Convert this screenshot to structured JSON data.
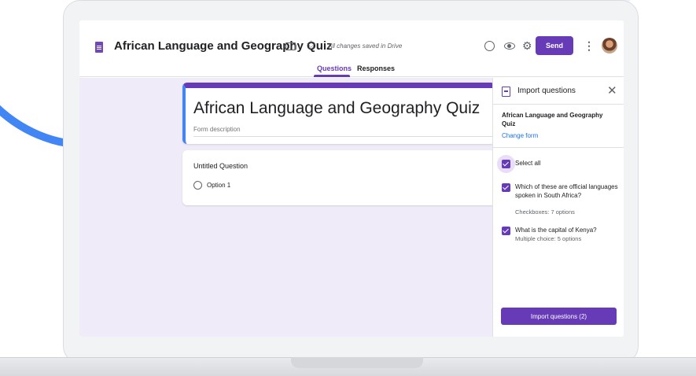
{
  "header": {
    "form_title": "African Language and Geography Quiz",
    "save_status": "All changes saved in Drive",
    "send_label": "Send",
    "icons": [
      "forms-doc-icon",
      "folder-icon",
      "star-icon",
      "palette-icon",
      "eye-icon",
      "gear-icon",
      "more-vert-icon",
      "avatar"
    ]
  },
  "tabs": [
    {
      "label": "Questions",
      "active": true
    },
    {
      "label": "Responses",
      "active": false
    }
  ],
  "form": {
    "title": "African Language and Geography Quiz",
    "description_placeholder": "Form description",
    "question": {
      "title": "Untitled Question",
      "options": [
        "Option 1"
      ]
    }
  },
  "import_panel": {
    "title": "Import questions",
    "source_form_name": "African Language and Geography Quiz",
    "change_form_label": "Change form",
    "select_all_label": "Select all",
    "select_all_checked": true,
    "items": [
      {
        "text": "Which of these are official languages spoken in South Africa?",
        "subtitle": "Checkboxes: 7 options",
        "checked": true
      },
      {
        "text": "What is the capital of Kenya?",
        "subtitle": "Multiple choice: 5 options",
        "checked": true
      }
    ],
    "import_button_label": "Import questions (2)"
  },
  "colors": {
    "accent": "#673ab7",
    "link": "#1a73e8",
    "canvas_bg": "#f0ebf8",
    "decor_arc": "#4285f4"
  }
}
